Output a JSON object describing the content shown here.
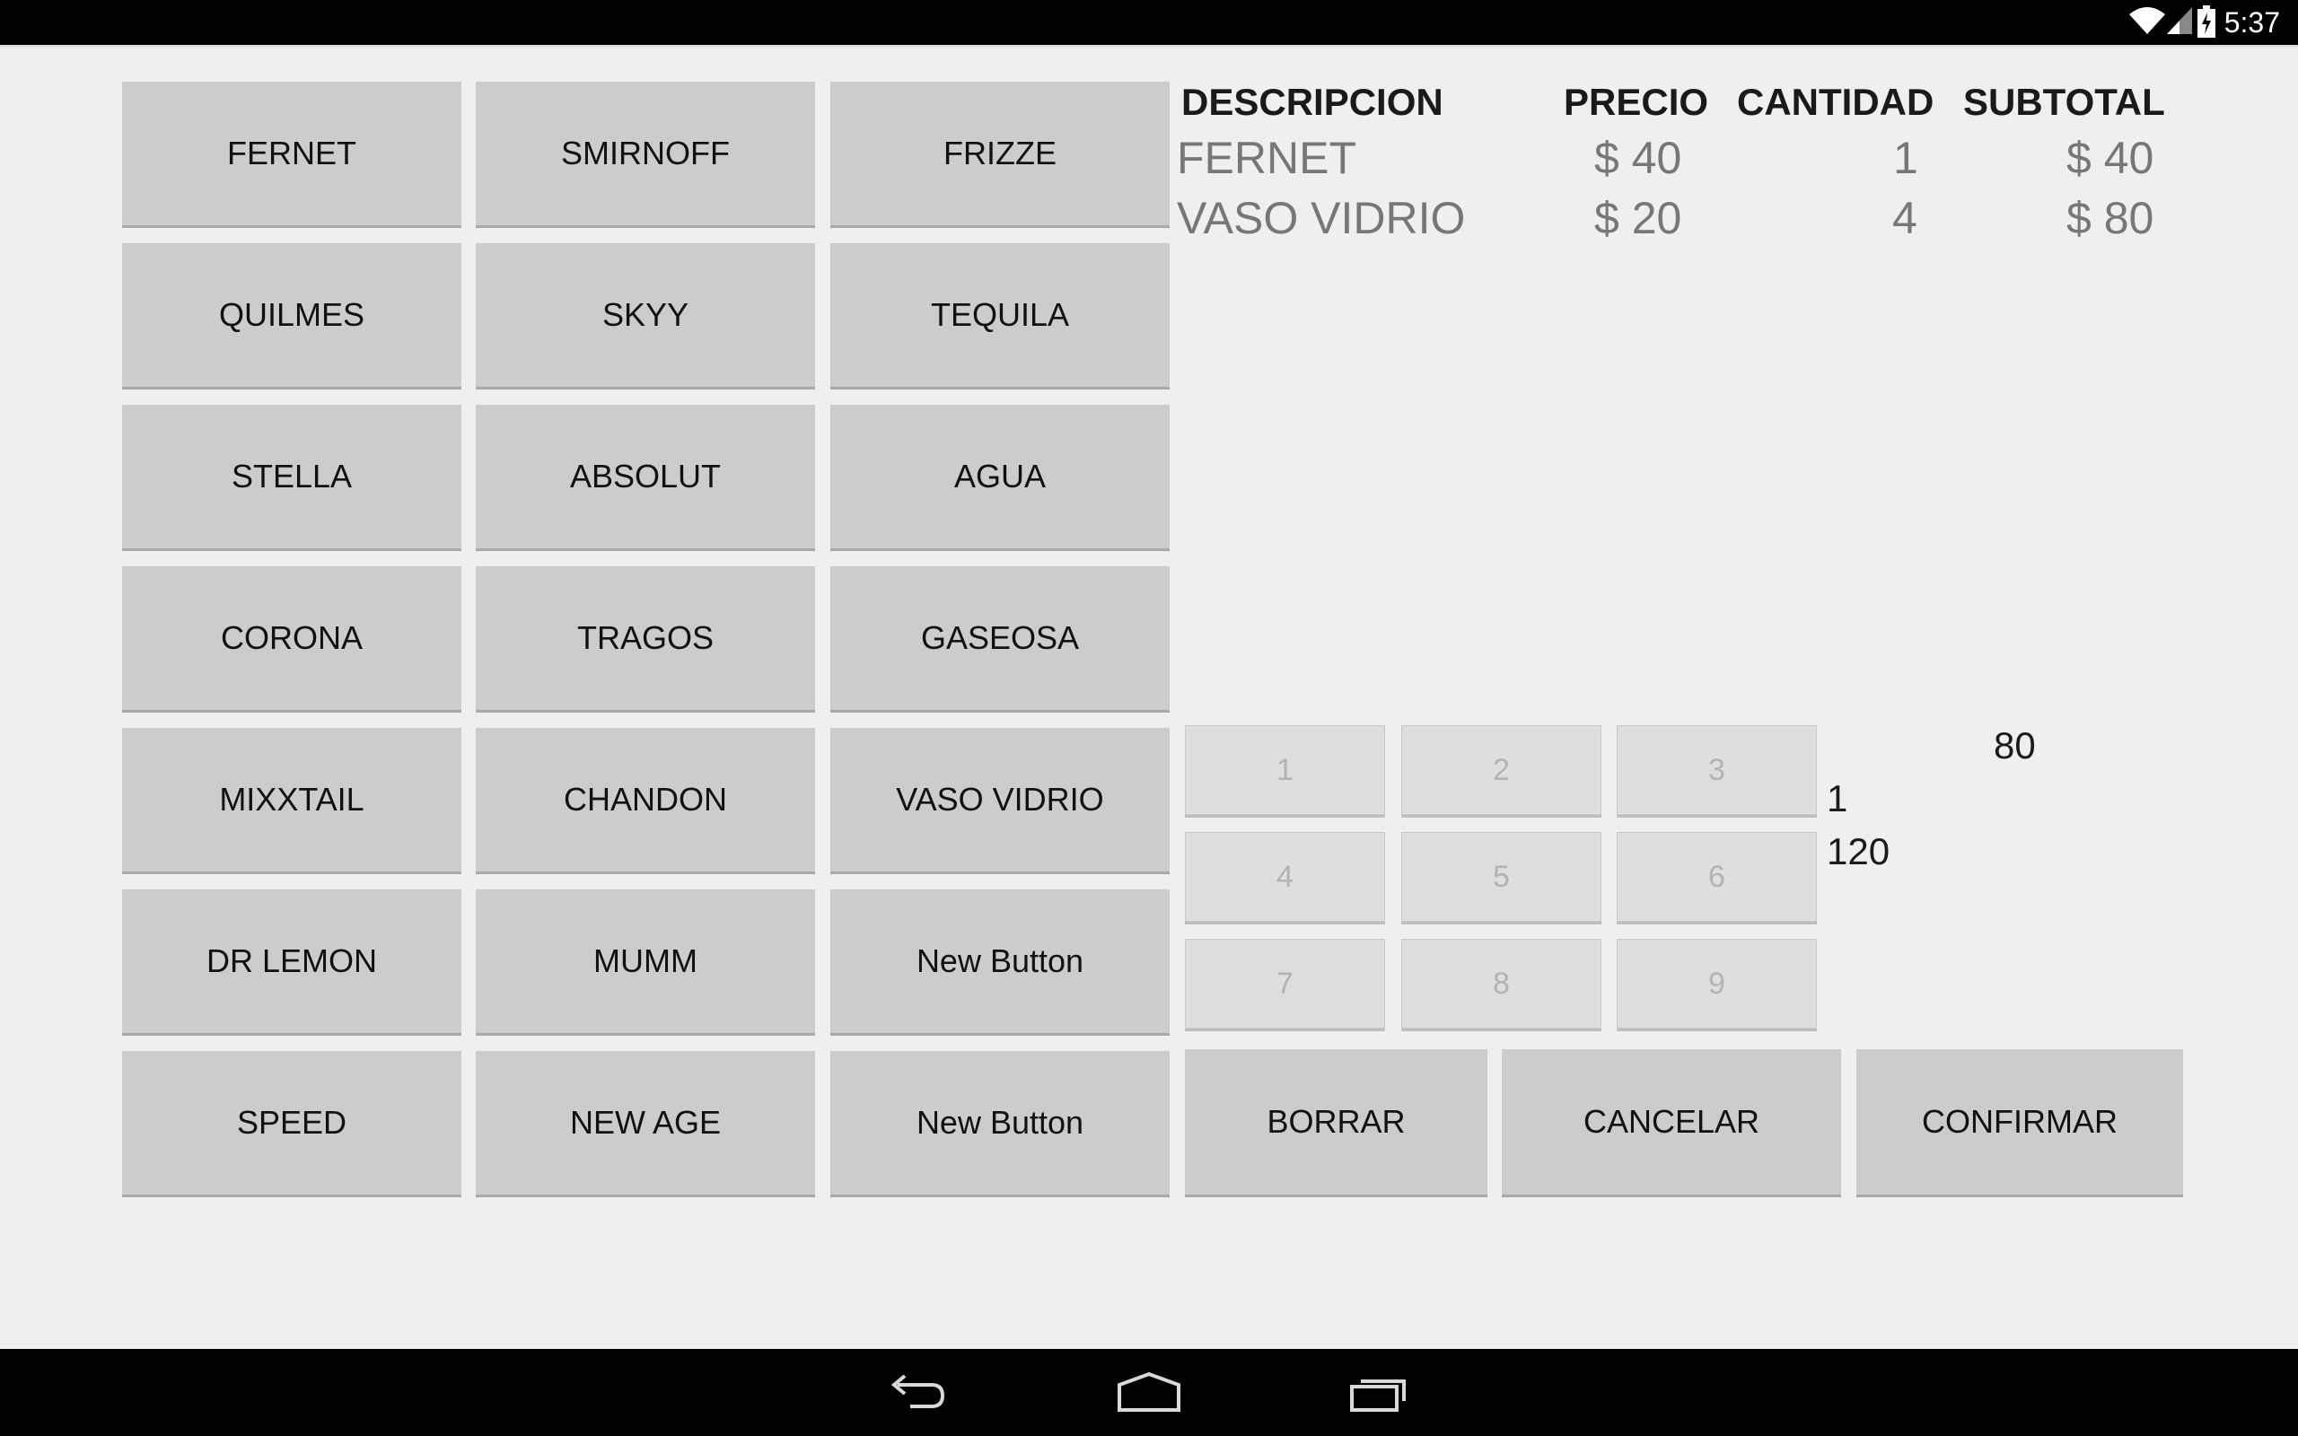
{
  "status_bar": {
    "time": "5:37",
    "icons": [
      "wifi-icon",
      "signal-icon",
      "battery-charging-icon"
    ]
  },
  "products": [
    "FERNET",
    "SMIRNOFF",
    "FRIZZE",
    "QUILMES",
    "SKYY",
    "TEQUILA",
    "STELLA",
    "ABSOLUT",
    "AGUA",
    "CORONA",
    "TRAGOS",
    "GASEOSA",
    "MIXXTAIL",
    "CHANDON",
    "VASO VIDRIO",
    "DR LEMON",
    "MUMM",
    "New Button",
    "SPEED",
    "NEW AGE",
    "New Button"
  ],
  "order_table": {
    "headers": {
      "description": "DESCRIPCION",
      "price": "PRECIO",
      "quantity": "CANTIDAD",
      "subtotal": "SUBTOTAL"
    },
    "rows": [
      {
        "description": "FERNET",
        "price": "$ 40",
        "quantity": "1",
        "subtotal": "$ 40"
      },
      {
        "description": "VASO VIDRIO",
        "price": "$ 20",
        "quantity": "4",
        "subtotal": "$ 80"
      }
    ]
  },
  "keypad": {
    "keys": [
      "1",
      "2",
      "3",
      "4",
      "5",
      "6",
      "7",
      "8",
      "9"
    ]
  },
  "side_values": {
    "top": "80",
    "quantity": "1",
    "total": "120"
  },
  "actions": {
    "borrar": "BORRAR",
    "cancelar": "CANCELAR",
    "confirmar": "CONFIRMAR"
  },
  "nav_bar": {
    "icons": [
      "back-icon",
      "home-icon",
      "recents-icon"
    ]
  },
  "colors": {
    "background": "#efefef",
    "button": "#cccccc",
    "keypad_key": "#dedede",
    "bar": "#000000"
  }
}
